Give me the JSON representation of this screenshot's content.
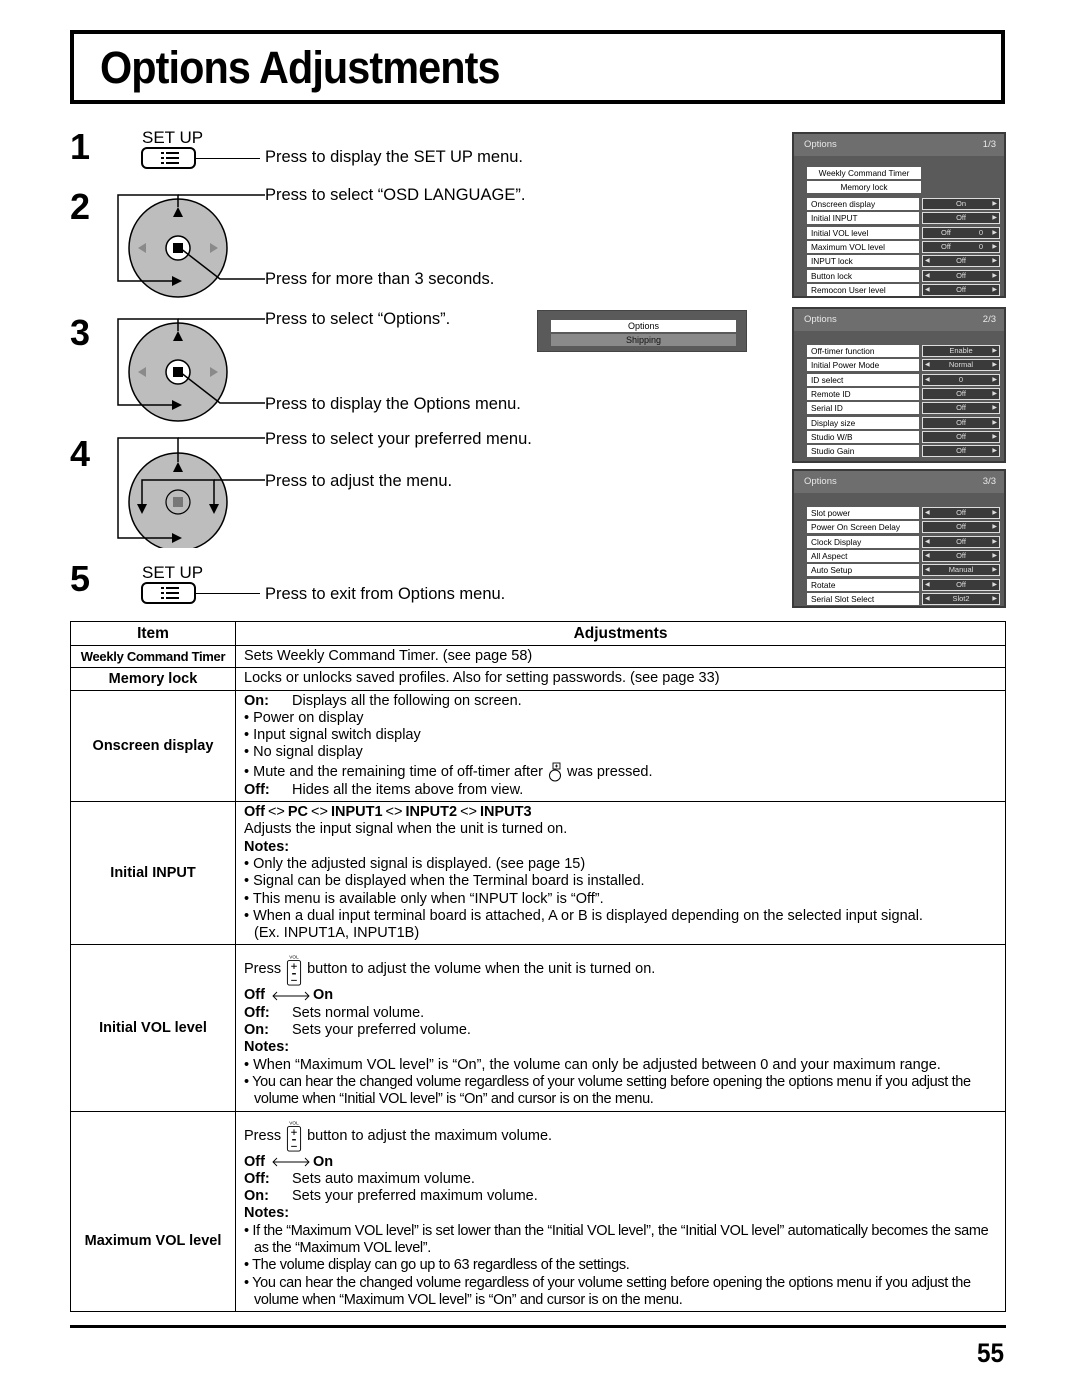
{
  "page": {
    "title": "Options Adjustments",
    "page_number": "55"
  },
  "steps": [
    {
      "num": "1",
      "button_label": "SET UP",
      "instructions": [
        "Press to display the SET UP menu."
      ]
    },
    {
      "num": "2",
      "instructions": [
        "Press to select “OSD LANGUAGE”.",
        "Press for more than 3 seconds."
      ]
    },
    {
      "num": "3",
      "instructions": [
        "Press to select “Options”.",
        "Press to display the Options menu."
      ]
    },
    {
      "num": "4",
      "instructions": [
        "Press to select your preferred menu.",
        "Press to adjust the menu."
      ]
    },
    {
      "num": "5",
      "button_label": "SET UP",
      "instructions": [
        "Press to exit from Options menu."
      ]
    }
  ],
  "submenu": {
    "items": [
      "Options",
      "Shipping"
    ],
    "selected": "Options"
  },
  "osd_menus": [
    {
      "title": "Options",
      "page": "1/3",
      "header_rows": [
        "Weekly Command Timer",
        "Memory lock"
      ],
      "rows": [
        {
          "label": "Onscreen display",
          "value": "On",
          "left_arrow": false
        },
        {
          "label": "Initial INPUT",
          "value": "Off",
          "left_arrow": false
        },
        {
          "label": "Initial VOL level",
          "value": "Off",
          "value2": "0",
          "left_arrow": false
        },
        {
          "label": "Maximum VOL level",
          "value": "Off",
          "value2": "0",
          "left_arrow": false
        },
        {
          "label": "INPUT lock",
          "value": "Off",
          "left_arrow": true
        },
        {
          "label": "Button lock",
          "value": "Off",
          "left_arrow": true
        },
        {
          "label": "Remocon User level",
          "value": "Off",
          "left_arrow": true
        }
      ]
    },
    {
      "title": "Options",
      "page": "2/3",
      "rows": [
        {
          "label": "Off-timer function",
          "value": "Enable",
          "left_arrow": false
        },
        {
          "label": "Initial Power Mode",
          "value": "Normal",
          "left_arrow": true
        },
        {
          "label": "ID select",
          "value": "0",
          "left_arrow": true
        },
        {
          "label": "Remote ID",
          "value": "Off",
          "left_arrow": false
        },
        {
          "label": "Serial ID",
          "value": "Off",
          "left_arrow": false
        },
        {
          "label": "Display size",
          "value": "Off",
          "left_arrow": false
        },
        {
          "label": "Studio W/B",
          "value": "Off",
          "left_arrow": false
        },
        {
          "label": "Studio Gain",
          "value": "Off",
          "left_arrow": false
        }
      ]
    },
    {
      "title": "Options",
      "page": "3/3",
      "rows": [
        {
          "label": "Slot power",
          "value": "Off",
          "left_arrow": true
        },
        {
          "label": "Power On Screen Delay",
          "value": "Off",
          "left_arrow": false
        },
        {
          "label": "Clock Display",
          "value": "Off",
          "left_arrow": true
        },
        {
          "label": "All Aspect",
          "value": "Off",
          "left_arrow": true
        },
        {
          "label": "Auto Setup",
          "value": "Manual",
          "left_arrow": true
        },
        {
          "label": "Rotate",
          "value": "Off",
          "left_arrow": true
        },
        {
          "label": "Serial Slot Select",
          "value": "Slot2",
          "left_arrow": true
        }
      ]
    }
  ],
  "table": {
    "headers": [
      "Item",
      "Adjustments"
    ],
    "rows": {
      "weekly": {
        "item": "Weekly Command Timer",
        "text": "Sets Weekly Command Timer. (see page 58)"
      },
      "memory": {
        "item": "Memory lock",
        "text": "Locks or unlocks saved profiles. Also for setting passwords. (see page 33)"
      },
      "onscreen": {
        "item": "Onscreen display",
        "on_label": "On:",
        "on_text": "Displays all the following on screen.",
        "bullets": [
          "Power on display",
          "Input signal switch display",
          "No signal display"
        ],
        "mute_before": "Mute and the remaining time of off-timer after",
        "mute_after": "was pressed.",
        "off_label": "Off:",
        "off_text": "Hides all the items above from view."
      },
      "initial_input": {
        "item": "Initial INPUT",
        "sequence": [
          "Off",
          "PC",
          "INPUT1",
          "INPUT2",
          "INPUT3"
        ],
        "text": "Adjusts the input signal when the unit is turned on.",
        "notes_label": "Notes:",
        "notes": [
          "Only the adjusted signal is displayed. (see page 15)",
          "Signal can be displayed when the Terminal board is installed.",
          "This menu is available only when “INPUT lock” is “Off”.",
          "When a dual input terminal board is attached, A or B is displayed depending on the selected input signal."
        ],
        "example": "(Ex. INPUT1A, INPUT1B)"
      },
      "initial_vol": {
        "item": "Initial VOL level",
        "press": "Press",
        "press_after": "button to adjust the volume when the unit is turned on.",
        "seq_off": "Off",
        "seq_on": "On",
        "off_label": "Off:",
        "off_text": "Sets normal volume.",
        "on_label": "On:",
        "on_text": "Sets your preferred volume.",
        "notes_label": "Notes:",
        "notes": [
          "When “Maximum VOL level” is “On”, the volume can only be adjusted between 0 and your maximum range.",
          "You can hear the changed volume regardless of your volume setting before opening the options menu if you adjust the volume when “Initial VOL level” is “On” and cursor is on the menu."
        ]
      },
      "max_vol": {
        "item": "Maximum VOL level",
        "press": "Press",
        "press_after": "button to adjust the maximum volume.",
        "seq_off": "Off",
        "seq_on": "On",
        "off_label": "Off:",
        "off_text": "Sets auto maximum volume.",
        "on_label": "On:",
        "on_text": "Sets your preferred maximum volume.",
        "notes_label": "Notes:",
        "notes": [
          "If the “Maximum VOL level” is set lower than the “Initial VOL level”, the “Initial VOL level” automatically becomes the same as the “Maximum VOL level”.",
          "The volume display can go up to 63 regardless of the settings.",
          "You can hear the changed volume regardless of your volume setting before opening the options menu if you adjust the volume when “Maximum VOL level” is “On” and cursor is on the menu."
        ]
      }
    },
    "vol_icon_label": "VOL"
  }
}
